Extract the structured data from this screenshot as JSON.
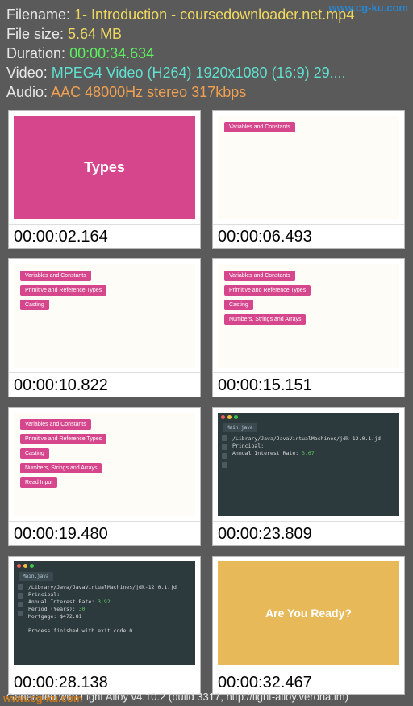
{
  "watermarks": {
    "top": "www.cg-ku.com",
    "bottom": "www.cg-ku.com"
  },
  "meta": {
    "labels": {
      "filename": "Filename:",
      "filesize": "File size:",
      "duration": "Duration:",
      "video": "Video:",
      "audio": "Audio:"
    },
    "filename": "1- Introduction - coursedownloader.net.mp4",
    "filesize": "5.64 MB",
    "duration": "00:00:34.634",
    "video": "MPEG4 Video (H264) 1920x1080 (16:9) 29....",
    "audio": "AAC 48000Hz stereo 317kbps"
  },
  "slides": {
    "types_title": "Types",
    "ready_text": "Are You Ready?",
    "bullets": {
      "b1": "Variables and Constants",
      "b2": "Primitive and Reference Types",
      "b3": "Casting",
      "b4": "Numbers, Strings and Arrays",
      "b5": "Read Input"
    },
    "term_tab": "Main.java",
    "term6_lines": {
      "l1": "/Library/Java/JavaVirtualMachines/jdk-12.0.1.jd",
      "l2": "Principal:",
      "l3a": "Annual Interest Rate: ",
      "l3b": "3.67"
    },
    "term7_lines": {
      "l1": "/Library/Java/JavaVirtualMachines/jdk-12.0.1.jd",
      "l2": "Principal:",
      "l3a": "Annual Interest Rate: ",
      "l3b": "3.92",
      "l4a": "Period (Years): ",
      "l4b": "30",
      "l5": "Mortgage: $472.81",
      "l6": "Process finished with exit code 0"
    }
  },
  "timecodes": {
    "t1": "00:00:02.164",
    "t2": "00:00:06.493",
    "t3": "00:00:10.822",
    "t4": "00:00:15.151",
    "t5": "00:00:19.480",
    "t6": "00:00:23.809",
    "t7": "00:00:28.138",
    "t8": "00:00:32.467"
  },
  "footer": "Generated with Light Alloy v4.10.2 (build 3317, http://light-alloy.verona.im)"
}
